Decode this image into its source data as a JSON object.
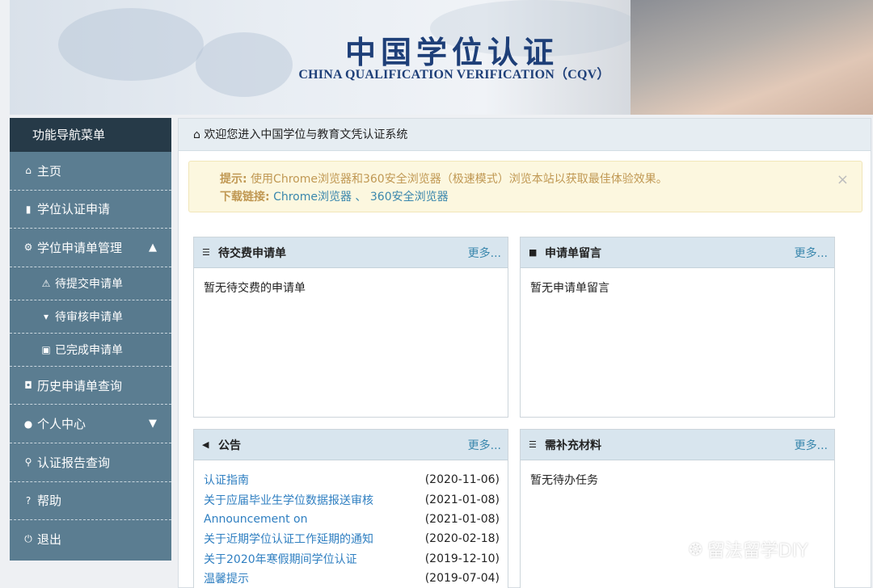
{
  "banner": {
    "title": "中国学位认证",
    "subtitle": "CHINA QUALIFICATION VERIFICATION（CQV）"
  },
  "sidebar": {
    "header": "功能导航菜单",
    "items": [
      {
        "label": "主页",
        "icon": "home-icon"
      },
      {
        "label": "学位认证申请",
        "icon": "file-icon"
      },
      {
        "label": "学位申请单管理",
        "icon": "gear-icon",
        "expanded": true
      },
      {
        "label": "待提交申请单",
        "icon": "warning-icon"
      },
      {
        "label": "待审核申请单",
        "icon": "cart-icon"
      },
      {
        "label": "已完成申请单",
        "icon": "briefcase-icon"
      },
      {
        "label": "历史申请单查询",
        "icon": "camera-icon"
      },
      {
        "label": "个人中心",
        "icon": "user-icon",
        "expanded": false
      },
      {
        "label": "认证报告查询",
        "icon": "search-icon"
      },
      {
        "label": "帮助",
        "icon": "help-icon"
      },
      {
        "label": "退出",
        "icon": "power-icon"
      }
    ]
  },
  "main": {
    "header": "欢迎您进入中国学位与教育文凭认证系统",
    "alert": {
      "tip_label": "提示:",
      "tip_text": " 使用Chrome浏览器和360安全浏览器（极速模式）浏览本站以获取最佳体验效果。",
      "download_label": "下载链接:",
      "link_chrome": "Chrome浏览器",
      "separator": " 、",
      "link_360": "360安全浏览器",
      "close": "×"
    },
    "panels": {
      "pending_payment": {
        "title": "待交费申请单",
        "more": "更多...",
        "empty": "暂无待交费的申请单"
      },
      "messages": {
        "title": "申请单留言",
        "more": "更多...",
        "empty": "暂无申请单留言"
      },
      "notices": {
        "title": "公告",
        "more": "更多...",
        "items": [
          {
            "title": "认证指南",
            "date": "(2020-11-06)"
          },
          {
            "title": "关于应届毕业生学位数据报送审核",
            "date": "(2021-01-08)"
          },
          {
            "title": "Announcement on",
            "date": "(2021-01-08)"
          },
          {
            "title": "关于近期学位认证工作延期的通知",
            "date": "(2020-02-18)"
          },
          {
            "title": "关于2020年寒假期间学位认证",
            "date": "(2019-12-10)"
          },
          {
            "title": "温馨提示",
            "date": "(2019-07-04)"
          }
        ]
      },
      "materials": {
        "title": "需补充材料",
        "more": "更多...",
        "empty": "暂无待办任务"
      }
    }
  },
  "watermark": "留法留学DIY",
  "colors": {
    "sidebar": "#5b7d91",
    "sidebar_header": "#263a48",
    "link": "#2f7fc1",
    "alert_bg": "#fcf7df",
    "title_blue": "#1e3f78"
  }
}
